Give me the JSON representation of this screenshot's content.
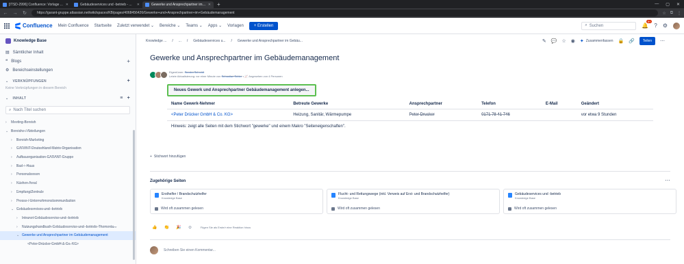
{
  "browser": {
    "tabs": [
      {
        "label": "[ITSD-2996] Confluence: Vorlage ..."
      },
      {
        "label": "Gebäudeservices und -betrieb - ..."
      },
      {
        "label": "Gewerke und Ansprechpartner im ..."
      }
    ],
    "url": "https://garant-gruppe.atlassian.net/wiki/spaces/KB/pages/4068456426/Gewerke+und+Ansprechpartner+im+Gebäudemanagement",
    "window_controls": [
      "—",
      "▢",
      "✕"
    ]
  },
  "header": {
    "logo_text": "Confluence",
    "nav": [
      "Mein Confluence",
      "Startseite",
      "Zuletzt verwendet ⌄",
      "Bereiche ⌄",
      "Teams ⌄",
      "Apps ⌄",
      "Vorlagen"
    ],
    "create_label": "+ Erstellen",
    "search_placeholder": "Suchen",
    "notification_count": "9+"
  },
  "sidebar": {
    "space_name": "Knowledge Base",
    "items": [
      {
        "label": "Sämtlicher Inhalt",
        "icon": "content-icon"
      },
      {
        "label": "Blogs",
        "icon": "quote-icon"
      },
      {
        "label": "Bereichseinstellungen",
        "icon": "gear-icon"
      }
    ],
    "shortcuts_header": "VERKNÜPFUNGEN",
    "shortcuts_hint": "Keine Verknüpfungen in diesem Bereich",
    "content_header": "INHALT",
    "filter_placeholder": "Nach Titel suchen",
    "tree": [
      {
        "label": "Meeting-Bereich",
        "level": 0
      },
      {
        "label": "Bereiche / Abteilungen",
        "level": 0
      },
      {
        "label": "Bereich Marketing",
        "level": 1
      },
      {
        "label": "GARANT Deutschland Matrix Organisation",
        "level": 1
      },
      {
        "label": "Aufbauorganisation GARANT Gruppe",
        "level": 1
      },
      {
        "label": "Bad + Haus",
        "level": 1
      },
      {
        "label": "Personalwesen",
        "level": 1
      },
      {
        "label": "Küchen Areal",
        "level": 1
      },
      {
        "label": "Empfang/Zentrale",
        "level": 1
      },
      {
        "label": "Presse / Unternehmenskommunikation",
        "level": 1
      },
      {
        "label": "Gebäudeservices und -betrieb",
        "level": 1
      },
      {
        "label": "Intranet Gebäudeservice und -betrieb",
        "level": 2
      },
      {
        "label": "Nutzungshandbuch Gebäudeservice und -betrieb: Thementa...",
        "level": 2
      },
      {
        "label": "Gewerke und Ansprechpartner im Gebäudemanagement",
        "level": 2,
        "selected": true
      },
      {
        "label": "<Peter Drücker GmbH & Co. KG>",
        "level": 3
      }
    ]
  },
  "page": {
    "breadcrumbs": [
      "Knowledge ...",
      "/",
      "...",
      "/",
      "Gebäudeservices u...",
      "/",
      "Gewerke und Ansprechpartner im Gebäu..."
    ],
    "summarize_label": "Zusammenfassen",
    "share_label": "Teilen",
    "title": "Gewerke und Ansprechpartner im Gebäudemanagement",
    "meta_owner_label": "Eigentümer:",
    "meta_owner": "Sandra Schmidt",
    "meta_updated_prefix": "Letzte Aktualisierung: vor einer Minute von",
    "meta_updated_by": "Sebastian Schier",
    "meta_views": "Angesehen von 4 Personen",
    "create_button": "Neues Gewerk und Ansprechpartner Gebäudemanagement anlegen...",
    "table": {
      "headers": [
        "Name Gewerk-Nehmer",
        "Betreute Gewerke",
        "Ansprechpartner",
        "Telefon",
        "E-Mail",
        "Geändert"
      ],
      "rows": [
        [
          "<Peter Drücker GmbH & Co. KG>",
          "Heizung, Sanitär, Wärmepumpe",
          "Peter Drucker",
          "0171 78 41 746",
          "",
          "vor etwa 9 Stunden"
        ]
      ]
    },
    "hint": "Hinweis: zeigt alle Seiten mit dem Stichwort \"gewerke\" und einem Makro \"Seiteneigenschaften\".",
    "add_label": "Stichwort hinzufügen",
    "related_title": "Zugehörige Seiten",
    "related": [
      {
        "title": "Ersthelfer / Brandschutzhelfer",
        "space": "Knowledge Base",
        "foot": "Wird oft zusammen gelesen"
      },
      {
        "title": "Flucht- und Rettungswege (inkl. Verweis auf Erst- und Brandschutzhelfer)",
        "space": "Knowledge Base",
        "foot": "Wird oft zusammen gelesen"
      },
      {
        "title": "Gebäudeservices und -betrieb",
        "space": "Knowledge Base",
        "foot": "Wird oft zusammen gelesen"
      }
    ],
    "reactions": [
      "👍",
      "👏",
      "🎉"
    ],
    "reaction_hint": "Fügen Sie als Erste/r eine Reaktion hinzu",
    "comment_placeholder": "Schreiben Sie einen Kommentar..."
  }
}
